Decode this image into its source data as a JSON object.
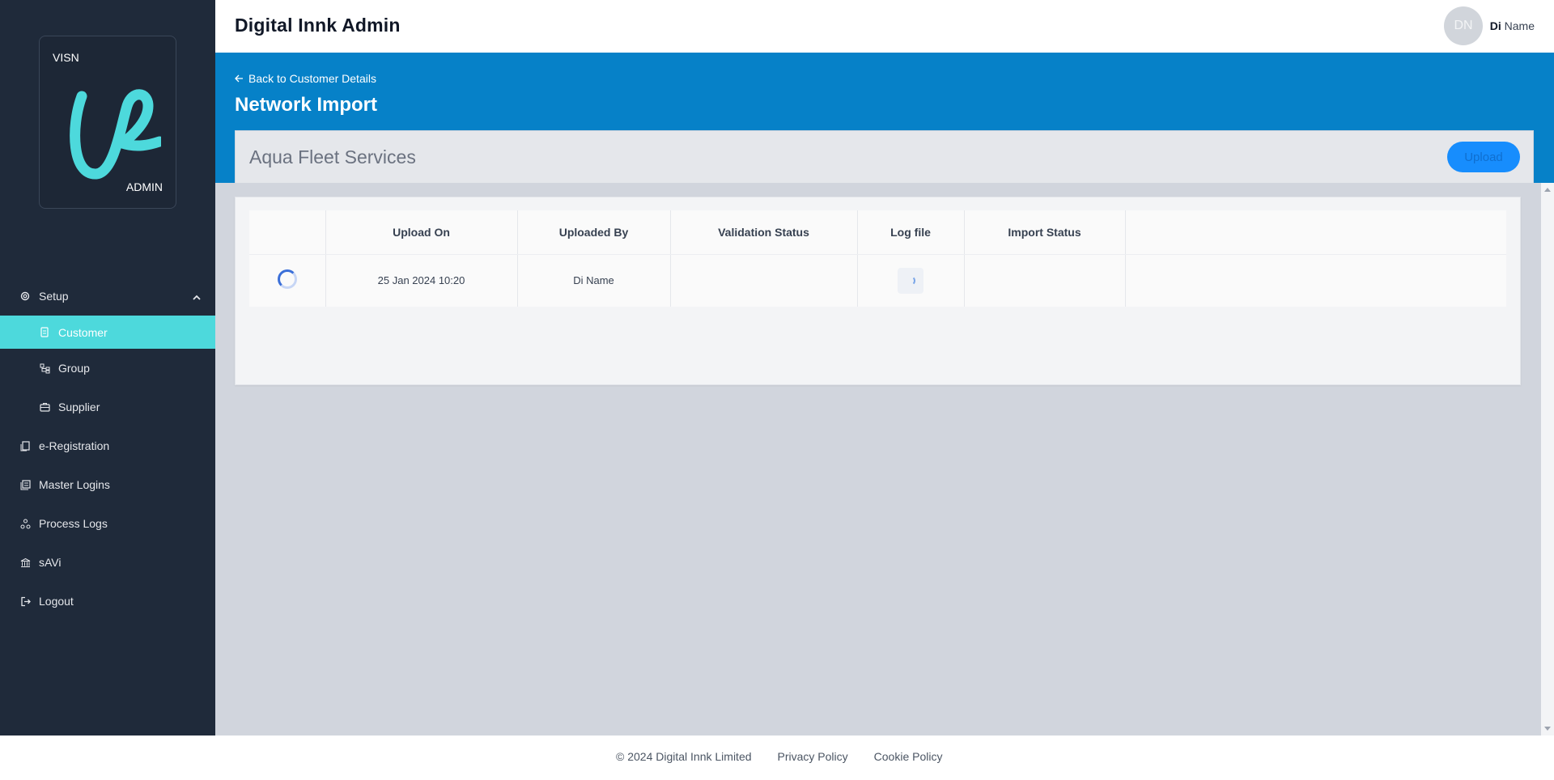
{
  "app": {
    "title": "Digital Innk Admin"
  },
  "user": {
    "initials": "DN",
    "first": "Di",
    "last": "Name"
  },
  "logo": {
    "top": "VISN",
    "bottom": "ADMIN"
  },
  "sidebar": {
    "items": [
      {
        "label": "Setup",
        "icon": "gear-icon"
      },
      {
        "label": "Customer",
        "icon": "document-icon",
        "active": true
      },
      {
        "label": "Group",
        "icon": "hierarchy-icon"
      },
      {
        "label": "Supplier",
        "icon": "briefcase-icon"
      },
      {
        "label": "e-Registration",
        "icon": "registration-icon"
      },
      {
        "label": "Master Logins",
        "icon": "logins-icon"
      },
      {
        "label": "Process Logs",
        "icon": "process-icon"
      },
      {
        "label": "sAVi",
        "icon": "bank-icon"
      },
      {
        "label": "Logout",
        "icon": "logout-icon"
      }
    ]
  },
  "banner": {
    "back_label": "Back to Customer Details",
    "title": "Network Import"
  },
  "company": {
    "name": "Aqua Fleet Services",
    "upload_label": "Upload"
  },
  "table": {
    "headers": [
      "",
      "Upload On",
      "Uploaded By",
      "Validation Status",
      "Log file",
      "Import Status",
      ""
    ],
    "rows": [
      {
        "upload_on": "25 Jan 2024 10:20",
        "uploaded_by": "Di Name",
        "validation_status": "",
        "import_status": ""
      }
    ]
  },
  "footer": {
    "copyright": "© 2024 Digital Innk Limited",
    "privacy": "Privacy Policy",
    "cookie": "Cookie Policy"
  },
  "colors": {
    "sidebar": "#1f2a3a",
    "accent": "#4dd9dc",
    "banner": "#0681c8",
    "upload": "#178dfd"
  }
}
